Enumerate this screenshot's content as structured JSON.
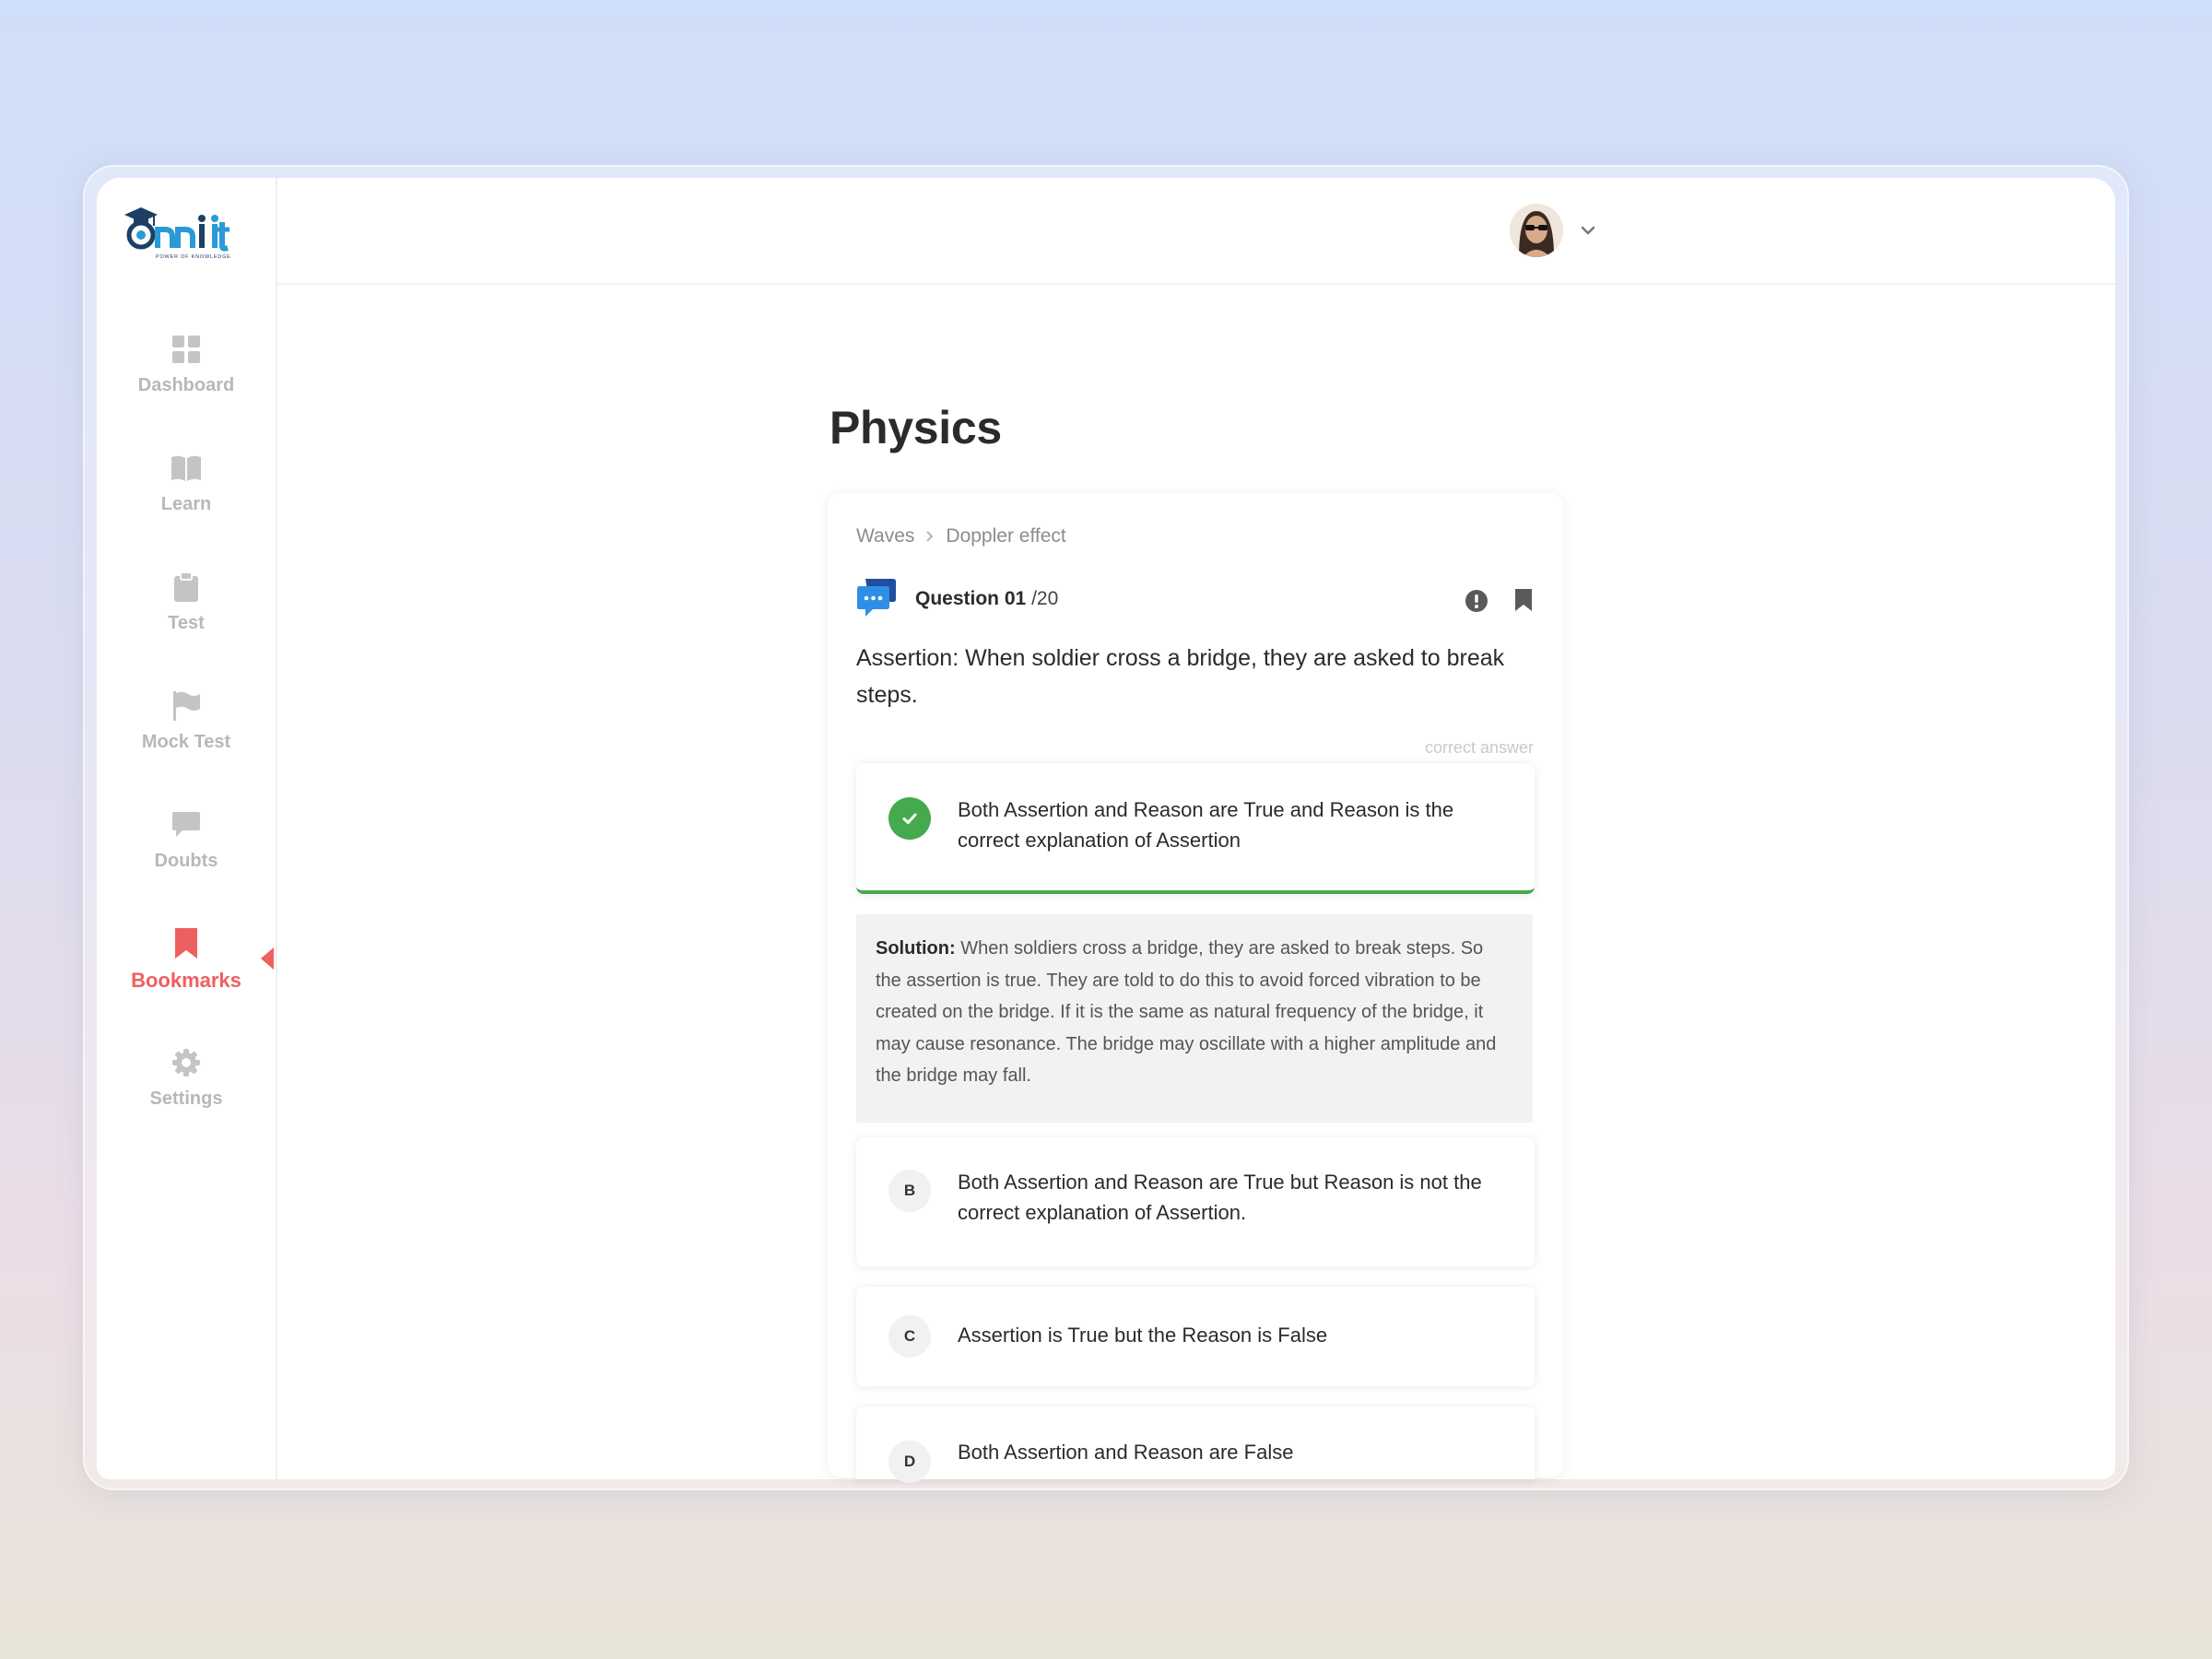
{
  "brand": {
    "logo_text": "nnit",
    "tagline": "POWER OF KNOWLEDGE"
  },
  "sidebar": {
    "items": [
      {
        "label": "Dashboard",
        "icon": "dashboard-grid-icon",
        "active": false
      },
      {
        "label": "Learn",
        "icon": "book-icon",
        "active": false
      },
      {
        "label": "Test",
        "icon": "clipboard-icon",
        "active": false
      },
      {
        "label": "Mock Test",
        "icon": "flag-icon",
        "active": false
      },
      {
        "label": "Doubts",
        "icon": "chat-bubble-icon",
        "active": false
      },
      {
        "label": "Bookmarks",
        "icon": "bookmark-icon",
        "active": true
      },
      {
        "label": "Settings",
        "icon": "gear-icon",
        "active": false
      }
    ]
  },
  "colors": {
    "accent": "#ee5f5f",
    "correct": "#45a94e",
    "question_icon": "#2f6fd6"
  },
  "page": {
    "title": "Physics"
  },
  "breadcrumb": {
    "items": [
      "Waves",
      "Doppler effect"
    ]
  },
  "question": {
    "label": "Question",
    "number": "01",
    "total": "/20",
    "text": "Assertion: When soldier cross a bridge, they are asked to break steps.",
    "correct_hint": "correct answer"
  },
  "options": [
    {
      "key": "A",
      "text": "Both Assertion and Reason are True and Reason is the correct explanation of Assertion",
      "correct": true
    },
    {
      "key": "B",
      "text": "Both Assertion and Reason are True but Reason is not the correct explanation of Assertion.",
      "correct": false
    },
    {
      "key": "C",
      "text": "Assertion is True but the Reason is False",
      "correct": false
    },
    {
      "key": "D",
      "text": "Both Assertion and Reason are False",
      "correct": false
    }
  ],
  "solution": {
    "label": "Solution:",
    "text": "When soldiers cross a bridge, they are asked to break steps. So the assertion is true. They are told to do this to avoid forced vibration to be created on the bridge. If it is the same as natural frequency of the bridge, it may cause resonance. The bridge may oscillate with a higher amplitude and the bridge may fall."
  }
}
